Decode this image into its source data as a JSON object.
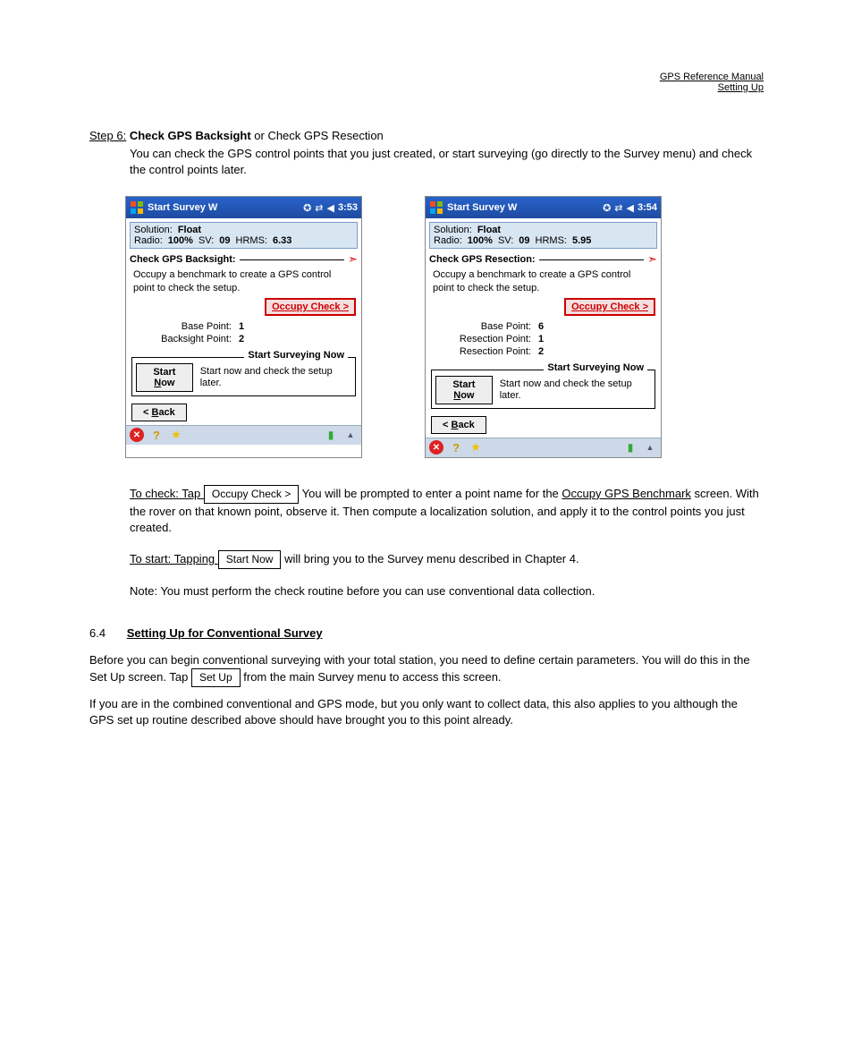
{
  "pageHeader": {
    "line1": "GPS Reference Manual",
    "line2": "Setting Up"
  },
  "step6": {
    "label": "Step 6:",
    "title": "Check GPS Backsight",
    "titleAlt": " or Check GPS Resection",
    "body": "You can check the GPS control points that you just created, or start surveying (go directly to the Survey menu) and check the control points later."
  },
  "devices": {
    "left": {
      "title": "Start Survey W",
      "time": "3:53",
      "status": {
        "solution": "Float",
        "radio": "100%",
        "sv": "09",
        "hrms": "6.33"
      },
      "section": "Check GPS Backsight:",
      "info": "Occupy a benchmark to create a GPS control point to check the setup.",
      "occupy": "Occupy Check >",
      "points": [
        {
          "label": "Base Point:",
          "val": "1"
        },
        {
          "label": "Backsight Point:",
          "val": "2"
        }
      ],
      "startGroup": {
        "title": "Start Surveying Now",
        "btn_pre": "Start ",
        "btn_u": "N",
        "btn_post": "ow",
        "text": "Start now and check the setup later."
      },
      "back": {
        "pre": "< ",
        "u": "B",
        "post": "ack"
      }
    },
    "right": {
      "title": "Start Survey W",
      "time": "3:54",
      "status": {
        "solution": "Float",
        "radio": "100%",
        "sv": "09",
        "hrms": "5.95"
      },
      "section": "Check GPS Resection:",
      "info": "Occupy a benchmark to create a GPS control point to check the setup.",
      "occupy": "Occupy Check >",
      "points": [
        {
          "label": "Base Point:",
          "val": "6"
        },
        {
          "label": "Resection Point:",
          "val": "1"
        },
        {
          "label": "Resection Point:",
          "val": "2"
        }
      ],
      "startGroup": {
        "title": "Start Surveying Now",
        "btn_pre": "Start ",
        "btn_u": "N",
        "btn_post": "ow",
        "text": "Start now and check the setup later."
      },
      "back": {
        "pre": "< ",
        "u": "B",
        "post": "ack"
      }
    }
  },
  "toCheck": {
    "intro": "To check: Tap ",
    "btn": "Occupy Check >",
    "rest": " You will be prompted to enter a point name for the ",
    "link": "Occupy GPS Benchmark",
    "rest2": " screen. With the rover on that known point, observe it. Then compute a localization solution, and apply it to the control points you just created."
  },
  "toStart": {
    "intro": "To start: Tapping ",
    "btn": "Start Now",
    "rest": " will bring you to the Survey menu described in Chapter 4."
  },
  "note": "Note: You must perform the check routine before you can use conventional data collection.",
  "section64": {
    "num": "6.4",
    "title": "Setting Up for Conventional Survey",
    "btn": "Set Up",
    "body1": "Before you can begin conventional surveying with your total station, you need to define certain parameters. You will do this in the Set Up screen. Tap ",
    "body1b": " from the main Survey menu to access this screen.",
    "body2": "If you are in the combined conventional and GPS mode, but you only want to collect data, this also applies to you although the GPS set up routine described above should have brought you to this point already."
  }
}
